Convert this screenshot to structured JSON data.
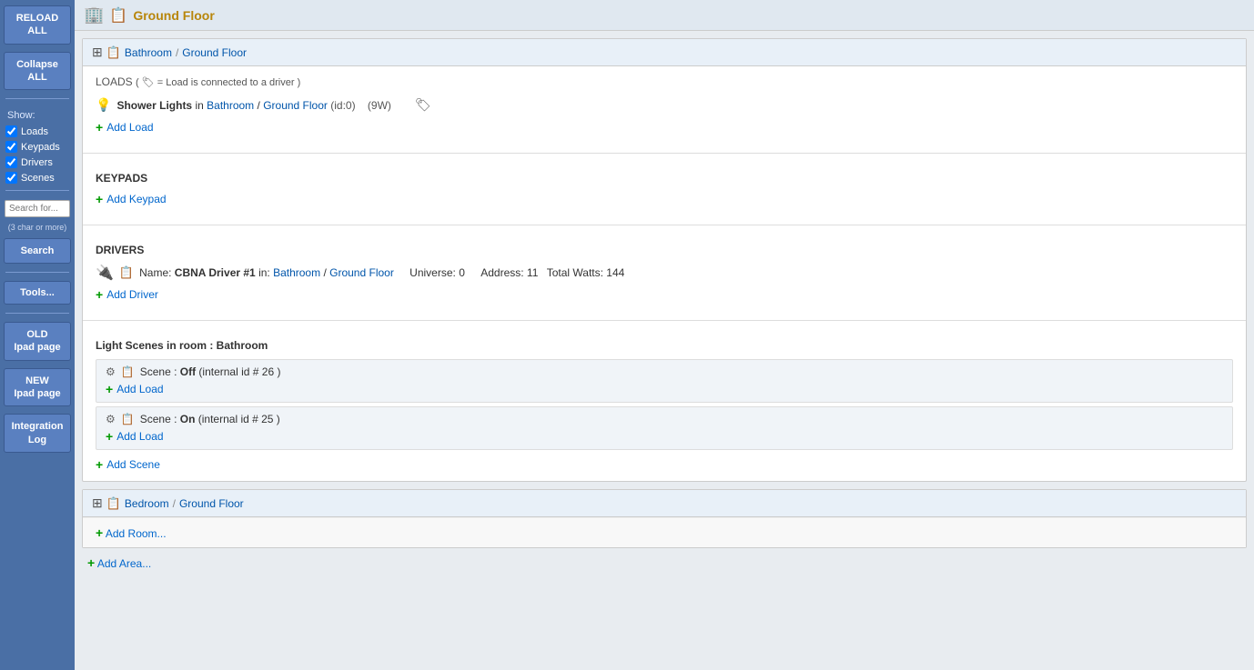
{
  "sidebar": {
    "reload_all": "RELOAD\nALL",
    "collapse_all": "Collapse\nALL",
    "show_label": "Show:",
    "checkboxes": [
      {
        "id": "loads",
        "label": "Loads",
        "checked": true
      },
      {
        "id": "keypads",
        "label": "Keypads",
        "checked": true
      },
      {
        "id": "drivers",
        "label": "Drivers",
        "checked": true
      },
      {
        "id": "scenes",
        "label": "Scenes",
        "checked": true
      }
    ],
    "search_placeholder": "Search for...",
    "search_hint": "(3 char or more)",
    "search_btn": "Search",
    "tools_btn": "Tools...",
    "old_ipad": "OLD\nIpad page",
    "new_ipad": "NEW\nIpad page",
    "integration_log": "Integration\nLog"
  },
  "header": {
    "icon": "🏠",
    "title": "Ground Floor"
  },
  "rooms": [
    {
      "id": "bathroom",
      "breadcrumb_room": "Bathroom",
      "breadcrumb_area": "Ground Floor",
      "loads_title": "LOADS",
      "loads_subtitle": " ( 🏷 = Load is connected to a driver )",
      "loads": [
        {
          "name": "Shower Lights",
          "in_text": "in",
          "room": "Bathroom",
          "area": "Ground Floor",
          "id_text": "(id:0)",
          "watts": "(9W)"
        }
      ],
      "add_load": "Add Load",
      "keypads_title": "KEYPADS",
      "add_keypad": "Add Keypad",
      "drivers_title": "DRIVERS",
      "drivers": [
        {
          "name": "CBNA Driver #1",
          "in_text": "in:",
          "room": "Bathroom",
          "area": "Ground Floor",
          "universe": "Universe: 0",
          "address": "Address: 11",
          "total_watts": "Total Watts: 144"
        }
      ],
      "add_driver": "Add Driver",
      "scenes_title": "Light Scenes in room : Bathroom",
      "scenes": [
        {
          "label": "Off",
          "id_text": "internal id # 26",
          "add_load": "Add Load"
        },
        {
          "label": "On",
          "id_text": "internal id # 25",
          "add_load": "Add Load"
        }
      ],
      "add_scene": "Add Scene"
    }
  ],
  "bedroom": {
    "breadcrumb_room": "Bedroom",
    "breadcrumb_area": "Ground Floor",
    "add_room": "Add Room..."
  },
  "add_area": "Add Area..."
}
